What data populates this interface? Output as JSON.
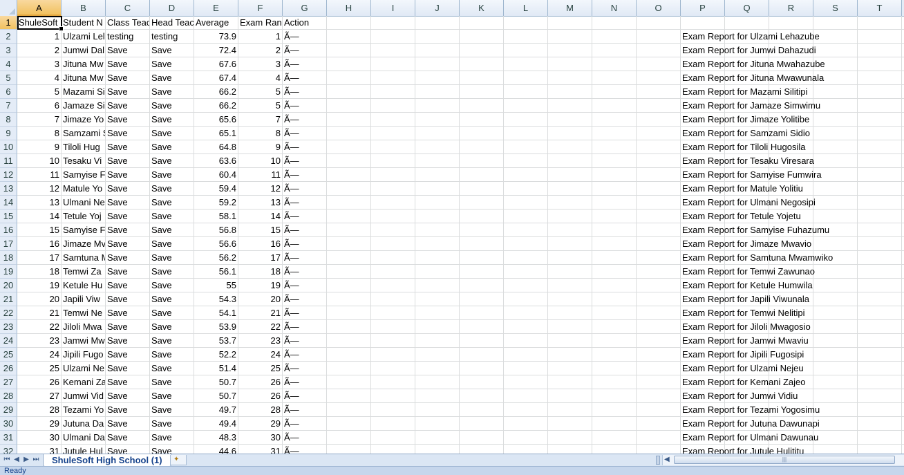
{
  "columns": [
    "A",
    "B",
    "C",
    "D",
    "E",
    "F",
    "G",
    "H",
    "I",
    "J",
    "K",
    "L",
    "M",
    "N",
    "O",
    "P",
    "Q",
    "R",
    "S",
    "T"
  ],
  "selected_column": "A",
  "selected_row": 1,
  "header_row": [
    "ShuleSoft",
    "Student N",
    "Class Teac",
    "Head Teac",
    "Average",
    "Exam Ranl",
    "Action"
  ],
  "rows": [
    {
      "n": 2,
      "a": "1",
      "b": "Ulzami Lel",
      "c": "testing",
      "d": "testing",
      "e": "73.9",
      "f": "1",
      "g": "Ã—",
      "p": "Exam Report for Ulzami Lehazube"
    },
    {
      "n": 3,
      "a": "2",
      "b": "Jumwi Dal",
      "c": "Save",
      "d": "Save",
      "e": "72.4",
      "f": "2",
      "g": "Ã—",
      "p": "Exam Report for Jumwi Dahazudi"
    },
    {
      "n": 4,
      "a": "3",
      "b": "Jituna Mw",
      "c": "Save",
      "d": "Save",
      "e": "67.6",
      "f": "3",
      "g": "Ã—",
      "p": "Exam Report for Jituna Mwahazube"
    },
    {
      "n": 5,
      "a": "4",
      "b": "Jituna Mw",
      "c": "Save",
      "d": "Save",
      "e": "67.4",
      "f": "4",
      "g": "Ã—",
      "p": "Exam Report for Jituna Mwawunala"
    },
    {
      "n": 6,
      "a": "5",
      "b": "Mazami Si",
      "c": "Save",
      "d": "Save",
      "e": "66.2",
      "f": "5",
      "g": "Ã—",
      "p": "Exam Report for Mazami Silitipi"
    },
    {
      "n": 7,
      "a": "6",
      "b": "Jamaze Si",
      "c": "Save",
      "d": "Save",
      "e": "66.2",
      "f": "5",
      "g": "Ã—",
      "p": "Exam Report for Jamaze Simwimu"
    },
    {
      "n": 8,
      "a": "7",
      "b": "Jimaze Yo",
      "c": "Save",
      "d": "Save",
      "e": "65.6",
      "f": "7",
      "g": "Ã—",
      "p": "Exam Report for Jimaze Yolitibe"
    },
    {
      "n": 9,
      "a": "8",
      "b": "Samzami S",
      "c": "Save",
      "d": "Save",
      "e": "65.1",
      "f": "8",
      "g": "Ã—",
      "p": "Exam Report for Samzami Sidio"
    },
    {
      "n": 10,
      "a": "9",
      "b": "Tiloli Hug",
      "c": "Save",
      "d": "Save",
      "e": "64.8",
      "f": "9",
      "g": "Ã—",
      "p": "Exam Report for Tiloli Hugosila"
    },
    {
      "n": 11,
      "a": "10",
      "b": "Tesaku Vi",
      "c": "Save",
      "d": "Save",
      "e": "63.6",
      "f": "10",
      "g": "Ã—",
      "p": "Exam Report for Tesaku Viresara"
    },
    {
      "n": 12,
      "a": "11",
      "b": "Samyise F",
      "c": "Save",
      "d": "Save",
      "e": "60.4",
      "f": "11",
      "g": "Ã—",
      "p": "Exam Report for Samyise Fumwira"
    },
    {
      "n": 13,
      "a": "12",
      "b": "Matule Yo",
      "c": "Save",
      "d": "Save",
      "e": "59.4",
      "f": "12",
      "g": "Ã—",
      "p": "Exam Report for Matule Yolitiu"
    },
    {
      "n": 14,
      "a": "13",
      "b": "Ulmani Ne",
      "c": "Save",
      "d": "Save",
      "e": "59.2",
      "f": "13",
      "g": "Ã—",
      "p": "Exam Report for Ulmani Negosipi"
    },
    {
      "n": 15,
      "a": "14",
      "b": "Tetule Yoj",
      "c": "Save",
      "d": "Save",
      "e": "58.1",
      "f": "14",
      "g": "Ã—",
      "p": "Exam Report for Tetule Yojetu"
    },
    {
      "n": 16,
      "a": "15",
      "b": "Samyise F",
      "c": "Save",
      "d": "Save",
      "e": "56.8",
      "f": "15",
      "g": "Ã—",
      "p": "Exam Report for Samyise Fuhazumu"
    },
    {
      "n": 17,
      "a": "16",
      "b": "Jimaze Mv",
      "c": "Save",
      "d": "Save",
      "e": "56.6",
      "f": "16",
      "g": "Ã—",
      "p": "Exam Report for Jimaze Mwavio"
    },
    {
      "n": 18,
      "a": "17",
      "b": "Samtuna M",
      "c": "Save",
      "d": "Save",
      "e": "56.2",
      "f": "17",
      "g": "Ã—",
      "p": "Exam Report for Samtuna Mwamwiko"
    },
    {
      "n": 19,
      "a": "18",
      "b": "Temwi Za",
      "c": "Save",
      "d": "Save",
      "e": "56.1",
      "f": "18",
      "g": "Ã—",
      "p": "Exam Report for Temwi Zawunao"
    },
    {
      "n": 20,
      "a": "19",
      "b": "Ketule Hu",
      "c": "Save",
      "d": "Save",
      "e": "55",
      "f": "19",
      "g": "Ã—",
      "p": "Exam Report for Ketule Humwila"
    },
    {
      "n": 21,
      "a": "20",
      "b": "Japili Viw",
      "c": "Save",
      "d": "Save",
      "e": "54.3",
      "f": "20",
      "g": "Ã—",
      "p": "Exam Report for Japili Viwunala"
    },
    {
      "n": 22,
      "a": "21",
      "b": "Temwi Ne",
      "c": "Save",
      "d": "Save",
      "e": "54.1",
      "f": "21",
      "g": "Ã—",
      "p": "Exam Report for Temwi Nelitipi"
    },
    {
      "n": 23,
      "a": "22",
      "b": "Jiloli Mwa",
      "c": "Save",
      "d": "Save",
      "e": "53.9",
      "f": "22",
      "g": "Ã—",
      "p": "Exam Report for Jiloli Mwagosio"
    },
    {
      "n": 24,
      "a": "23",
      "b": "Jamwi Mw",
      "c": "Save",
      "d": "Save",
      "e": "53.7",
      "f": "23",
      "g": "Ã—",
      "p": "Exam Report for Jamwi Mwaviu"
    },
    {
      "n": 25,
      "a": "24",
      "b": "Jipili Fugo",
      "c": "Save",
      "d": "Save",
      "e": "52.2",
      "f": "24",
      "g": "Ã—",
      "p": "Exam Report for Jipili Fugosipi"
    },
    {
      "n": 26,
      "a": "25",
      "b": "Ulzami Ne",
      "c": "Save",
      "d": "Save",
      "e": "51.4",
      "f": "25",
      "g": "Ã—",
      "p": "Exam Report for Ulzami Nejeu"
    },
    {
      "n": 27,
      "a": "26",
      "b": "Kemani Za",
      "c": "Save",
      "d": "Save",
      "e": "50.7",
      "f": "26",
      "g": "Ã—",
      "p": "Exam Report for Kemani Zajeo"
    },
    {
      "n": 28,
      "a": "27",
      "b": "Jumwi Vid",
      "c": "Save",
      "d": "Save",
      "e": "50.7",
      "f": "26",
      "g": "Ã—",
      "p": "Exam Report for Jumwi Vidiu"
    },
    {
      "n": 29,
      "a": "28",
      "b": "Tezami Yo",
      "c": "Save",
      "d": "Save",
      "e": "49.7",
      "f": "28",
      "g": "Ã—",
      "p": "Exam Report for Tezami Yogosimu"
    },
    {
      "n": 30,
      "a": "29",
      "b": "Jutuna Da",
      "c": "Save",
      "d": "Save",
      "e": "49.4",
      "f": "29",
      "g": "Ã—",
      "p": "Exam Report for Jutuna Dawunapi"
    },
    {
      "n": 31,
      "a": "30",
      "b": "Ulmani Da",
      "c": "Save",
      "d": "Save",
      "e": "48.3",
      "f": "30",
      "g": "Ã—",
      "p": "Exam Report for Ulmani Dawunau"
    },
    {
      "n": 32,
      "a": "31",
      "b": "Jutule Hul",
      "c": "Save",
      "d": "Save",
      "e": "44.6",
      "f": "31",
      "g": "Ã—",
      "p": "Exam Report for Jutule Hulititu"
    }
  ],
  "sheet_tabs": [
    "ShuleSoft High School (1)"
  ],
  "nav_buttons": [
    "⏮",
    "◀",
    "▶",
    "⏭"
  ],
  "status": "Ready"
}
